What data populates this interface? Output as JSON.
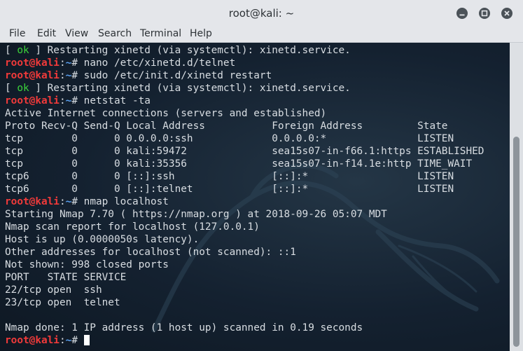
{
  "window": {
    "title": "root@kali: ~"
  },
  "icons": {
    "minimize": "minimize-icon",
    "maximize": "maximize-icon",
    "close": "close-icon"
  },
  "menu": [
    "File",
    "Edit",
    "View",
    "Search",
    "Terminal",
    "Help"
  ],
  "colors": {
    "terminal_bg": "#142130",
    "prompt_user": "#f03a3a",
    "prompt_path": "#5aa0f0",
    "ok": "#3bd23b",
    "text": "#d8dde2"
  },
  "terminal": {
    "prompt_user": "root@kali",
    "prompt_sep": ":",
    "prompt_path": "~",
    "prompt_end": "# ",
    "lines": [
      {
        "type": "ok",
        "pre": "[ ",
        "ok": "ok",
        "post": " ] Restarting xinetd (via systemctl): xinetd.service."
      },
      {
        "type": "cmd",
        "text": "nano /etc/xinetd.d/telnet"
      },
      {
        "type": "cmd",
        "text": "sudo /etc/init.d/xinetd restart"
      },
      {
        "type": "ok",
        "pre": "[ ",
        "ok": "ok",
        "post": " ] Restarting xinetd (via systemctl): xinetd.service."
      },
      {
        "type": "cmd",
        "text": "netstat -ta"
      },
      {
        "type": "out",
        "text": "Active Internet connections (servers and established)"
      },
      {
        "type": "out",
        "text": "Proto Recv-Q Send-Q Local Address           Foreign Address         State"
      },
      {
        "type": "out",
        "text": "tcp        0      0 0.0.0.0:ssh             0.0.0.0:*               LISTEN"
      },
      {
        "type": "out",
        "text": "tcp        0      0 kali:59472              sea15s07-in-f66.1:https ESTABLISHED"
      },
      {
        "type": "out",
        "text": "tcp        0      0 kali:35356              sea15s07-in-f14.1e:http TIME_WAIT"
      },
      {
        "type": "out",
        "text": "tcp6       0      0 [::]:ssh                [::]:*                  LISTEN"
      },
      {
        "type": "out",
        "text": "tcp6       0      0 [::]:telnet             [::]:*                  LISTEN"
      },
      {
        "type": "cmd",
        "text": "nmap localhost"
      },
      {
        "type": "out",
        "text": "Starting Nmap 7.70 ( https://nmap.org ) at 2018-09-26 05:07 MDT"
      },
      {
        "type": "out",
        "text": "Nmap scan report for localhost (127.0.0.1)"
      },
      {
        "type": "out",
        "text": "Host is up (0.0000050s latency)."
      },
      {
        "type": "out",
        "text": "Other addresses for localhost (not scanned): ::1"
      },
      {
        "type": "out",
        "text": "Not shown: 998 closed ports"
      },
      {
        "type": "out",
        "text": "PORT   STATE SERVICE"
      },
      {
        "type": "out",
        "text": "22/tcp open  ssh"
      },
      {
        "type": "out",
        "text": "23/tcp open  telnet"
      },
      {
        "type": "out",
        "text": ""
      },
      {
        "type": "out",
        "text": "Nmap done: 1 IP address (1 host up) scanned in 0.19 seconds"
      },
      {
        "type": "cmd",
        "text": "",
        "cursor": true
      }
    ]
  }
}
